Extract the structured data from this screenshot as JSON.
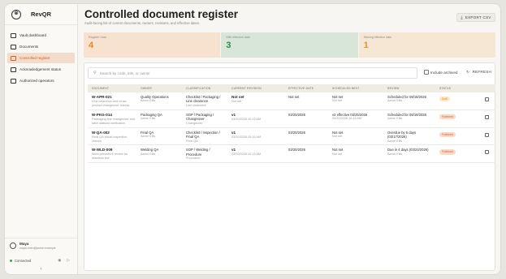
{
  "app": {
    "name": "RevQR"
  },
  "sidebar": {
    "items": [
      {
        "label": "Vault dashboard",
        "icon": "dashboard-icon",
        "active": false
      },
      {
        "label": "Documents",
        "icon": "document-icon",
        "active": false
      },
      {
        "label": "Controlled register",
        "icon": "register-icon",
        "active": true
      },
      {
        "label": "Acknowledgement status",
        "icon": "ack-icon",
        "active": false
      },
      {
        "label": "Authorized operators",
        "icon": "operators-icon",
        "active": false
      }
    ],
    "user": {
      "name": "Maya",
      "email": "maya.chen@acme.example"
    },
    "connection": "Connected",
    "collapse": "‹"
  },
  "header": {
    "title": "Controlled document register",
    "subtitle": "Audit-facing list of current documents, owners, revisions, and effective dates.",
    "export_label": "EXPORT CSV"
  },
  "stats": [
    {
      "label": "Register rows",
      "value": "4"
    },
    {
      "label": "With effective date",
      "value": "3"
    },
    {
      "label": "Missing effective date",
      "value": "1"
    }
  ],
  "toolbar": {
    "search_placeholder": "Search by code, title, or owner",
    "include_archived": "Include archived",
    "refresh": "REFRESH"
  },
  "table": {
    "columns": [
      "DOCUMENT",
      "OWNER",
      "CLASSIFICATION",
      "CURRENT REVISION",
      "EFFECTIVE DATE",
      "SCHEDULED NEXT",
      "REVIEW",
      "STATUS",
      ""
    ],
    "rows": [
      {
        "code": "W-APR-021",
        "desc": "Line clearance and reuse product changeover checks",
        "owner": "Quality Operations",
        "owner_sub": "Aaron Ellis",
        "class": "Checklist / Packaging / Line clearance",
        "class_sub": "Line clearance",
        "rev": "Not set",
        "rev_sub": "Not set",
        "eff": "Not set",
        "sched": "Not set",
        "sched_sub": "Not set",
        "review": "Scheduled for 08/18/2026",
        "review_sub": "Aaron Ellis",
        "review_sub2": "",
        "status": "Draft",
        "status_kind": "draft"
      },
      {
        "code": "W-PKG-014",
        "desc": "Packaging line changeover and label stations verification",
        "owner": "Packaging QA",
        "owner_sub": "Aaron Ellis",
        "class": "SOP / Packaging / Changeover",
        "class_sub": "Changeover",
        "rev": "v1",
        "rev_sub": "03/20/2026 10:15 AM",
        "eff": "03/20/2026",
        "sched": "v2 effective 03/25/2026",
        "sched_sub": "03/20/2026 10:16 AM",
        "review": "Scheduled for 05/19/2026",
        "review_sub": "Aaron Ellis",
        "review_sub2": "",
        "status": "Published",
        "status_kind": "published"
      },
      {
        "code": "W-QA-002",
        "desc": "Final QA visual inspection checks",
        "owner": "Final QA",
        "owner_sub": "Aaron Ellis",
        "class": "Checklist / Inspection / Final QA",
        "class_sub": "Final QA",
        "rev": "v1",
        "rev_sub": "03/20/2026 10:16 AM",
        "eff": "03/20/2026",
        "sched": "Not set",
        "sched_sub": "Not set",
        "review": "Overdue by 5 days (03/17/2026)",
        "review_sub": "Aaron Ellis",
        "review_sub2": "",
        "status": "Published",
        "status_kind": "published"
      },
      {
        "code": "W-WLD-009",
        "desc": "Weld procedure review for stainless line",
        "owner": "Welding QA",
        "owner_sub": "Aaron Ellis",
        "class": "SOP / Welding / Procedure",
        "class_sub": "Procedure",
        "rev": "v1",
        "rev_sub": "03/20/2026 10:15 AM",
        "eff": "03/20/2026",
        "sched": "Not set",
        "sched_sub": "Not set",
        "review": "Due in 4 days (03/24/2026)",
        "review_sub": "Aaron Ellis",
        "review_sub2": "",
        "status": "Published",
        "status_kind": "published"
      }
    ]
  }
}
